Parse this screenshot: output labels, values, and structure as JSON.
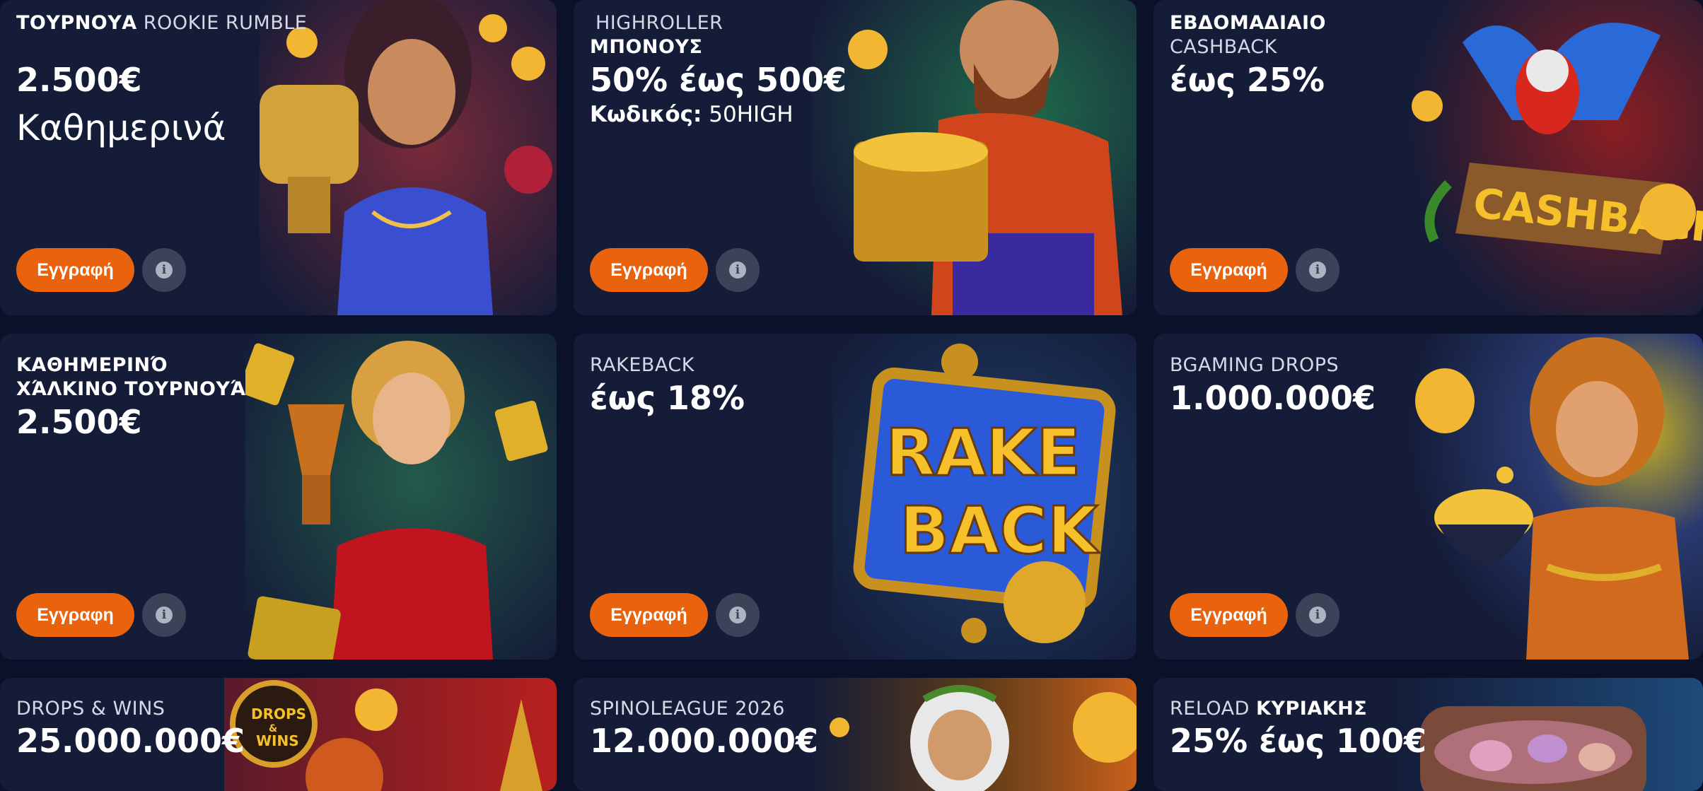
{
  "colors": {
    "page_bg": "#0b1128",
    "card_bg": "#141c38",
    "button_orange": "#e9620e",
    "info_bg": "#3c4358"
  },
  "cards": [
    {
      "title_bold": "ΤΟΥΡΝΟΥΑ",
      "title_rest": " ROOKIE RUMBLE",
      "big1": "2.500€",
      "big2": "Καθημερινά",
      "button": "Εγγραφή",
      "info_icon": "info-icon",
      "art_theme": "woman-with-golden-trophy"
    },
    {
      "title_line1": "HIGHROLLER",
      "title_line2": "ΜΠΟΝΟΥΣ",
      "big1": "50% έως 500€",
      "code_label": "Κωδικός:",
      "code_value": " 50HIGH",
      "button": "Εγγραφή",
      "info_icon": "info-icon",
      "art_theme": "bearded-man-with-gold-chest"
    },
    {
      "title_line1": "ΕΒΔΟΜΑΔΙΑΙΟ",
      "title_line2": "CASHBACK",
      "big1": "έως 25%",
      "art_text": "CASHBACK",
      "button": "Εγγραφή",
      "info_icon": "info-icon",
      "art_theme": "parrot-on-cashback-sign"
    },
    {
      "title_line1": "ΚΑΘΗΜΕΡΙΝΌ",
      "title_line2": "ΧΆΛΚΙΝΟ ΤΟΥΡΝΟΥΆ",
      "big1": "2.500€",
      "button": "Εγγραφη",
      "info_icon": "info-icon",
      "art_theme": "woman-in-red-dress-with-trophy"
    },
    {
      "title_line1": "RAKEBACK",
      "big1": "έως 18%",
      "art_text1": "RAKE",
      "art_text2": "BACK",
      "button": "Εγγραφή",
      "info_icon": "info-icon",
      "art_theme": "rakeback-golden-sign"
    },
    {
      "title_line1": "BGAMING DROPS",
      "big1": "1.000.000€",
      "button": "Εγγραφή",
      "info_icon": "info-icon",
      "art_theme": "woman-with-pot-of-gold"
    },
    {
      "title_line1": "DROPS & WINS",
      "big1": "25.000.000€",
      "art_text1": "DROPS",
      "art_text2": "&",
      "art_text3": "WINS",
      "art_theme": "drops-and-wins-badge"
    },
    {
      "title_line1": "SPINOLEAGUE 2026",
      "big1": "12.000.000€",
      "art_theme": "zeus-with-coins"
    },
    {
      "title_normal": "RELOAD ",
      "title_bold": "ΚΥΡΙΑΚΗΣ",
      "big1": "25% έως 100€",
      "art_theme": "treasure-chest-gems"
    }
  ]
}
